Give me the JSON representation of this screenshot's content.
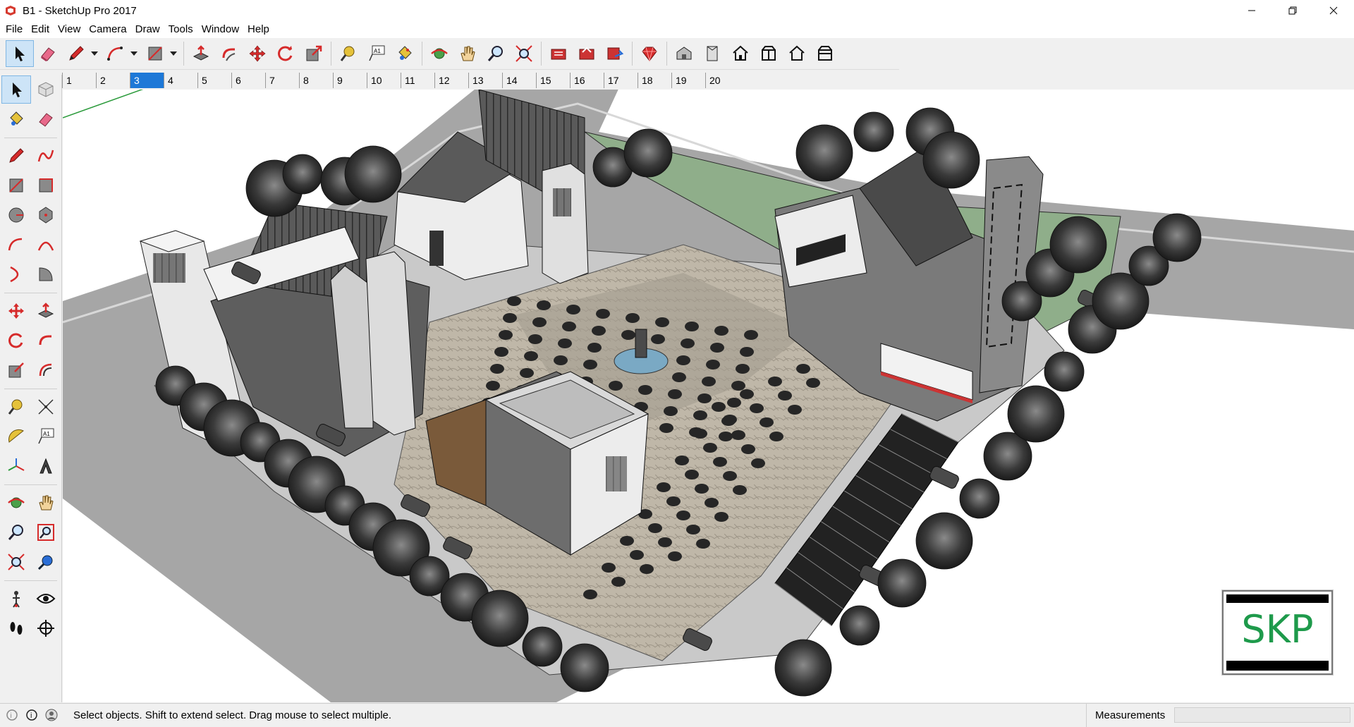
{
  "window": {
    "title": "B1 - SketchUp Pro 2017"
  },
  "menu": [
    "File",
    "Edit",
    "View",
    "Camera",
    "Draw",
    "Tools",
    "Window",
    "Help"
  ],
  "scenes": {
    "tabs": [
      "1",
      "2",
      "3",
      "4",
      "5",
      "6",
      "7",
      "8",
      "9",
      "10",
      "11",
      "12",
      "13",
      "14",
      "15",
      "16",
      "17",
      "18",
      "19",
      "20"
    ],
    "active_index": 2
  },
  "status": {
    "message": "Select objects. Shift to extend select. Drag mouse to select multiple.",
    "measurements_label": "Measurements",
    "measurements_value": ""
  },
  "badge": {
    "text": "SKP"
  },
  "colors": {
    "accent": "#1e78d7",
    "badge_green": "#1e9a4b",
    "tool_red": "#d62b2b"
  }
}
